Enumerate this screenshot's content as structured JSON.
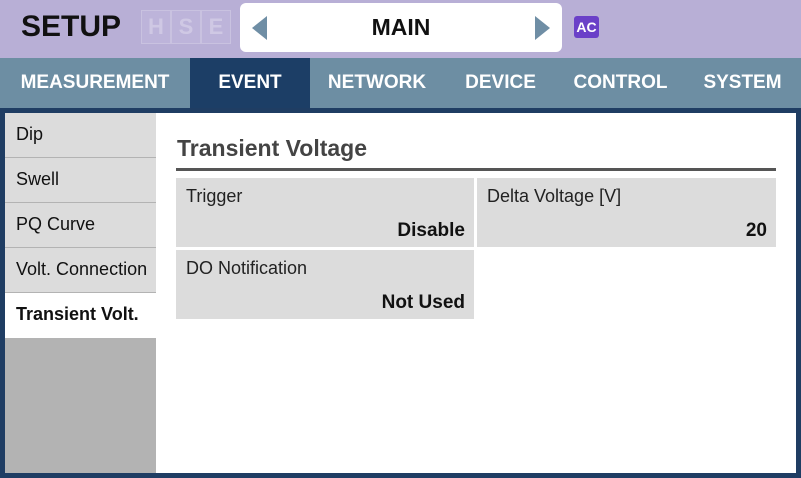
{
  "header": {
    "title": "SETUP",
    "hse": [
      "H",
      "S",
      "E"
    ],
    "page_selector": {
      "current": "MAIN"
    },
    "ac_badge": "AC"
  },
  "tabs": [
    {
      "label": "MEASUREMENT",
      "active": false
    },
    {
      "label": "EVENT",
      "active": true
    },
    {
      "label": "NETWORK",
      "active": false
    },
    {
      "label": "DEVICE",
      "active": false
    },
    {
      "label": "CONTROL",
      "active": false
    },
    {
      "label": "SYSTEM",
      "active": false
    }
  ],
  "sidebar": {
    "items": [
      {
        "label": "Dip",
        "active": false
      },
      {
        "label": "Swell",
        "active": false
      },
      {
        "label": "PQ Curve",
        "active": false
      },
      {
        "label": "Volt. Connection",
        "active": false
      },
      {
        "label": "Transient Volt.",
        "active": true
      }
    ]
  },
  "main": {
    "section_title": "Transient Voltage",
    "settings": [
      {
        "label": "Trigger",
        "value": "Disable"
      },
      {
        "label": "Delta Voltage [V]",
        "value": "20"
      },
      {
        "label": "DO Notification",
        "value": "Not Used"
      }
    ]
  },
  "colors": {
    "header_bg": "#b8afd6",
    "tabbar_bg": "#6d8ea3",
    "active_tab_bg": "#1c3e66",
    "ac_badge_bg": "#6a40c8"
  }
}
